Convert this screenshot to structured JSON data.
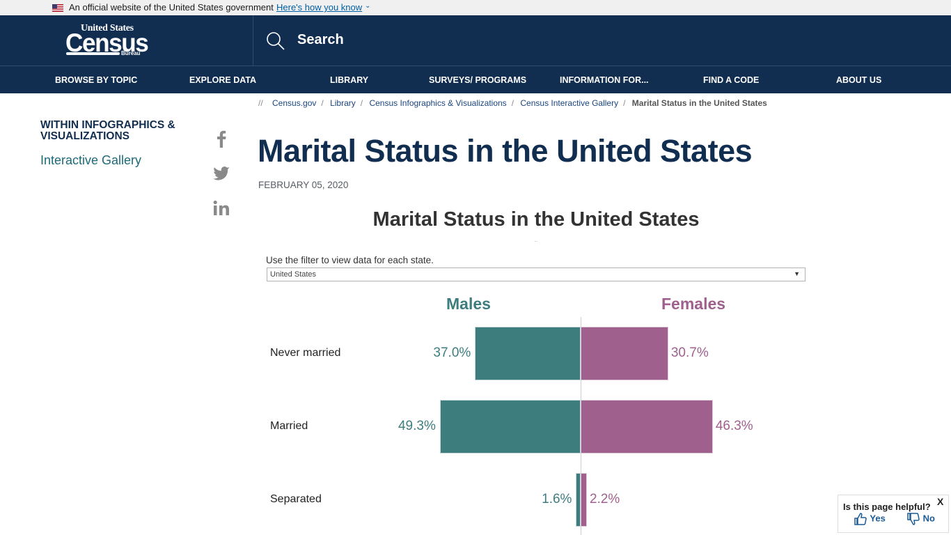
{
  "gov_banner": {
    "text": "An official website of the United States government",
    "link": "Here's how you know"
  },
  "header": {
    "logo": {
      "top": "United States",
      "main": "Census",
      "bottom": "Bureau"
    },
    "search_label": "Search"
  },
  "nav": [
    {
      "label": "BROWSE BY TOPIC"
    },
    {
      "label": "EXPLORE DATA"
    },
    {
      "label": "LIBRARY"
    },
    {
      "label": "SURVEYS/ PROGRAMS"
    },
    {
      "label": "INFORMATION FOR..."
    },
    {
      "label": "FIND A CODE"
    },
    {
      "label": "ABOUT US"
    }
  ],
  "breadcrumb": {
    "prefix": "//",
    "items": [
      "Census.gov",
      "Library",
      "Census Infographics & Visualizations",
      "Census Interactive Gallery"
    ],
    "current": "Marital Status in the United States"
  },
  "sidebar": {
    "heading": "WITHIN INFOGRAPHICS & VISUALIZATIONS",
    "link": "Interactive Gallery",
    "social": [
      "facebook",
      "twitter",
      "linkedin"
    ]
  },
  "page": {
    "title": "Marital Status in the United States",
    "date": "FEBRUARY 05, 2020"
  },
  "viz": {
    "title": "Marital Status in the United States",
    "filter_label": "Use the filter to view data for each state.",
    "filter_value": "United States"
  },
  "feedback": {
    "question": "Is this page helpful?",
    "yes": "Yes",
    "no": "No",
    "close": "X"
  },
  "chart_data": {
    "type": "bar",
    "orientation": "horizontal-diverging",
    "title": "Marital Status in the United States",
    "categories": [
      "Never married",
      "Married",
      "Separated"
    ],
    "series": [
      {
        "name": "Males",
        "color": "#3d7d7e",
        "values": [
          37.0,
          49.3,
          1.6
        ],
        "labels": [
          "37.0%",
          "49.3%",
          "1.6%"
        ]
      },
      {
        "name": "Females",
        "color": "#a0608d",
        "values": [
          30.7,
          46.3,
          2.2
        ],
        "labels": [
          "30.7%",
          "46.3%",
          "2.2%"
        ]
      }
    ],
    "unit": "%",
    "legend": "top",
    "grid": false
  }
}
